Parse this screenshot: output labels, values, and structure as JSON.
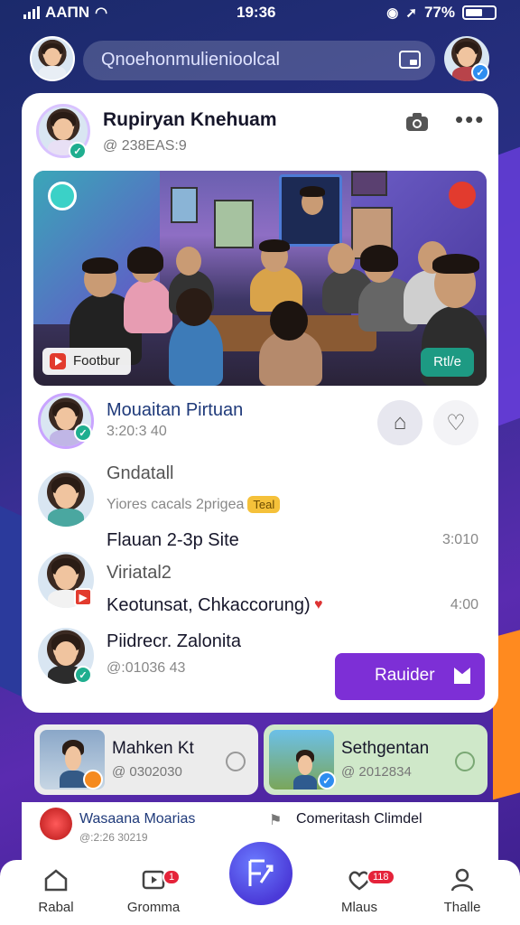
{
  "status_bar": {
    "carrier": "AAΠN",
    "time": "19:36",
    "battery_text": "77%"
  },
  "search": {
    "placeholder": "Qnoehonmulienioolcal"
  },
  "post": {
    "author": "Rupiryan Knehuam",
    "handle": "@ 238EAS:9",
    "photo_tag_left": "Footbur",
    "photo_tag_right": "Rtl/e"
  },
  "rows": [
    {
      "name": "Mouaitan Pirtuan",
      "sub": "3:20:3 40"
    },
    {
      "name": "Gndatall",
      "sub": "Yiores cacals 2prigea",
      "chip": "Teal"
    },
    {
      "name": "Flauan 2-3p Site",
      "time": "3:010"
    },
    {
      "name": "Viriatal2",
      "line": "Keotunsat, Chkaccorung)",
      "time": "4:00"
    },
    {
      "name": "Piidrecr. Zalonita",
      "sub": "@:01036 43"
    }
  ],
  "remind_button": "Rauider",
  "mini_cards": [
    {
      "title": "Mahken Kt",
      "sub": "@ 0302030",
      "color": "#ececec"
    },
    {
      "title": "Sethgentan",
      "sub": "@ 2012834",
      "color": "#cfe8c9"
    }
  ],
  "strip": [
    {
      "title": "Wasaana Moarias",
      "sub": "@:2:26 30219"
    },
    {
      "title": "Comeritash Climdel"
    }
  ],
  "nav": {
    "items": [
      {
        "label": "Rabal",
        "icon": "home-icon"
      },
      {
        "label": "Gromma",
        "icon": "video-icon",
        "badge": "1"
      },
      {
        "label": "Mlaus",
        "icon": "heart-chat-icon",
        "badge": "118"
      },
      {
        "label": "Thalle",
        "icon": "profile-icon"
      }
    ]
  },
  "colors": {
    "accent": "#7d2fd6",
    "fab": "#4b3ad8",
    "live": "#1d9a83"
  }
}
